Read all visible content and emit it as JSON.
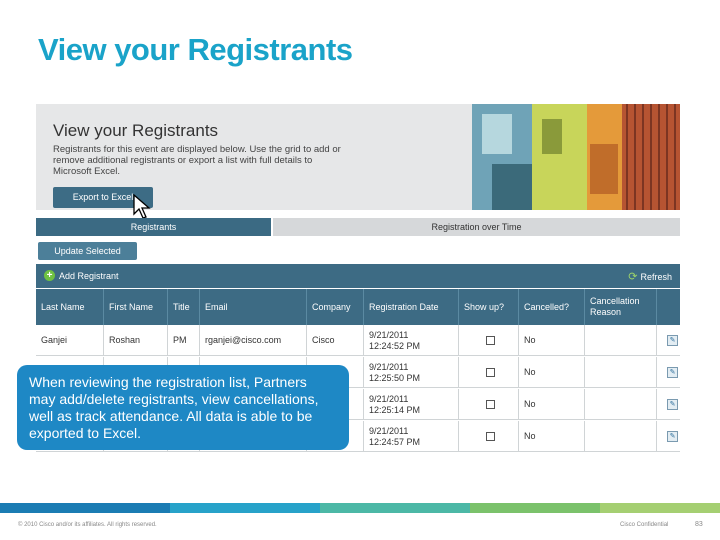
{
  "slide": {
    "title": "View your Registrants"
  },
  "hero": {
    "heading": "View your Registrants",
    "description": "Registrants for this event are displayed below. Use the grid to add or remove additional registrants or export a list with full details to Microsoft Excel.",
    "export_label": "Export to Excel"
  },
  "tabs": {
    "registrants": "Registrants",
    "registration_over_time": "Registration over Time"
  },
  "update_selected_label": "Update Selected",
  "toolbar": {
    "add_registrant": "Add Registrant",
    "refresh": "Refresh"
  },
  "table": {
    "headers": {
      "last_name": "Last Name",
      "first_name": "First Name",
      "title": "Title",
      "email": "Email",
      "company": "Company",
      "registration_date": "Registration Date",
      "show_up": "Show up?",
      "cancelled": "Cancelled?",
      "cancellation_reason": "Cancellation Reason"
    },
    "rows": [
      {
        "last_name": "Ganjei",
        "first_name": "Roshan",
        "title": "PM",
        "email": "rganjei@cisco.com",
        "company": "Cisco",
        "date": "9/21/2011",
        "time": "12:24:52 PM",
        "cancelled": "No"
      },
      {
        "last_name": "",
        "first_name": "",
        "title": "",
        "email": "",
        "company": "",
        "date": "9/21/2011",
        "time": "12:25:50 PM",
        "cancelled": "No"
      },
      {
        "last_name": "",
        "first_name": "",
        "title": "",
        "email": "",
        "company": "",
        "date": "9/21/2011",
        "time": "12:25:14 PM",
        "cancelled": "No"
      },
      {
        "last_name": "",
        "first_name": "",
        "title": "",
        "email": "",
        "company": "",
        "date": "9/21/2011",
        "time": "12:24:57 PM",
        "cancelled": "No"
      }
    ]
  },
  "callout": {
    "text": "When reviewing the registration list, Partners may add/delete registrants, view cancellations, well as track attendance. All data is able to be exported to Excel."
  },
  "footer": {
    "copyright": "© 2010 Cisco and/or its affiliates. All rights reserved.",
    "confidential": "Cisco Confidential",
    "page": "83"
  },
  "colors": {
    "title": "#1aa3c9",
    "grid_header": "#3d6b84",
    "callout": "#1e88c5"
  }
}
